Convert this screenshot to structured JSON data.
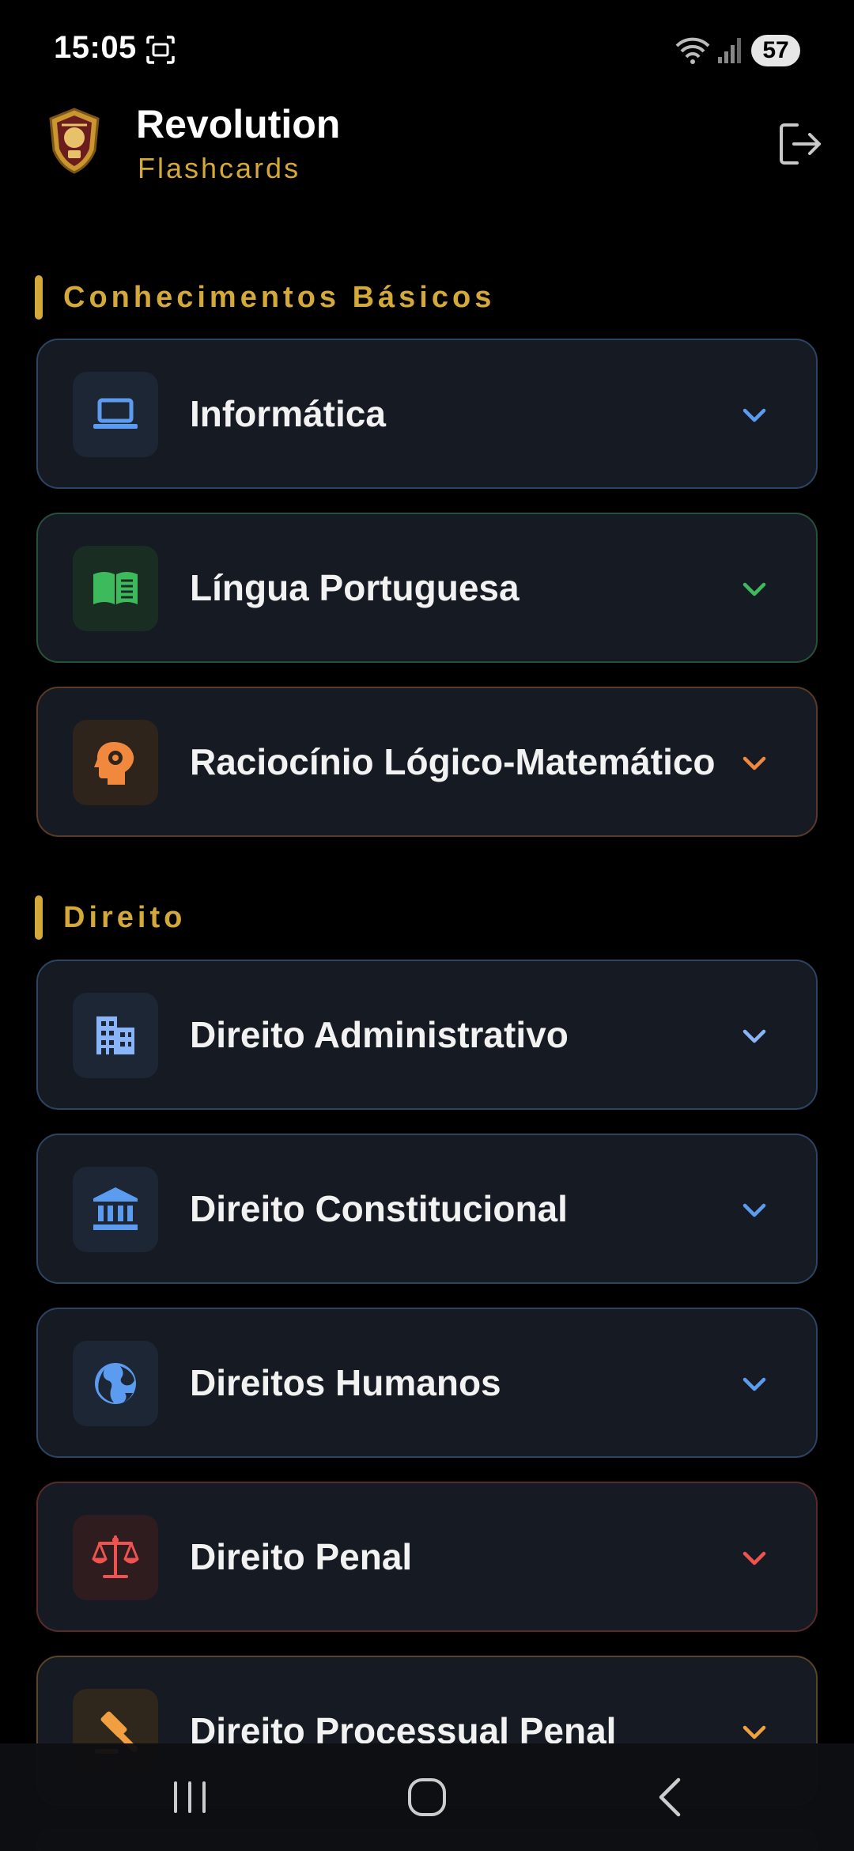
{
  "status_bar": {
    "time": "15:05",
    "battery": "57",
    "icons": [
      "screenshot-icon",
      "wifi-icon",
      "signal-icon"
    ]
  },
  "header": {
    "title": "Revolution",
    "subtitle": "Flashcards",
    "logout_icon": "logout-icon"
  },
  "sections": [
    {
      "title": "Conhecimentos Básicos",
      "items": [
        {
          "label": "Informática",
          "icon": "laptop-icon",
          "accent": "#5b9cf0"
        },
        {
          "label": "Língua Portuguesa",
          "icon": "book-icon",
          "accent": "#3dbb5c"
        },
        {
          "label": "Raciocínio Lógico-Matemático",
          "icon": "brain-gear-icon",
          "accent": "#f0883e"
        }
      ]
    },
    {
      "title": "Direito",
      "items": [
        {
          "label": "Direito Administrativo",
          "icon": "building-icon",
          "accent": "#8ab4f8"
        },
        {
          "label": "Direito Constitucional",
          "icon": "bank-icon",
          "accent": "#5b9cf0"
        },
        {
          "label": "Direitos Humanos",
          "icon": "globe-icon",
          "accent": "#5b9cf0"
        },
        {
          "label": "Direito Penal",
          "icon": "scales-icon",
          "accent": "#ef5350"
        },
        {
          "label": "Direito Processual Penal",
          "icon": "gavel-icon",
          "accent": "#f0a040"
        }
      ]
    }
  ],
  "colors": {
    "background": "#000000",
    "section_accent": "#d4a93a",
    "card_background": "#161a22"
  },
  "nav_bar": {
    "icons": [
      "recents-icon",
      "home-icon",
      "back-icon"
    ]
  }
}
